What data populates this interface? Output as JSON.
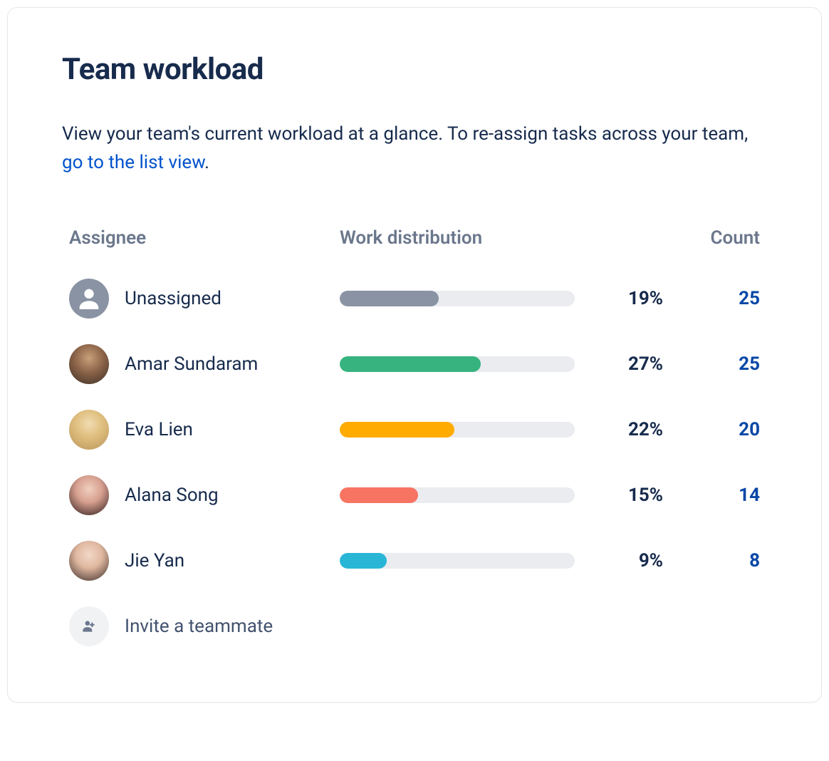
{
  "title": "Team workload",
  "description_prefix": "View your team's current workload at a glance. To re-assign tasks across your team, ",
  "description_link": "go to the list view",
  "description_suffix": ".",
  "columns": {
    "assignee": "Assignee",
    "distribution": "Work distribution",
    "count": "Count"
  },
  "rows": [
    {
      "name": "Unassigned",
      "percent": 19,
      "percent_label": "19%",
      "count": 25,
      "color": "#8993a4",
      "avatar": "unassigned"
    },
    {
      "name": "Amar Sundaram",
      "percent": 27,
      "percent_label": "27%",
      "count": 25,
      "color": "#36b37e",
      "avatar": "photo-1"
    },
    {
      "name": "Eva Lien",
      "percent": 22,
      "percent_label": "22%",
      "count": 20,
      "color": "#ffab00",
      "avatar": "photo-2"
    },
    {
      "name": "Alana Song",
      "percent": 15,
      "percent_label": "15%",
      "count": 14,
      "color": "#f87462",
      "avatar": "photo-3"
    },
    {
      "name": "Jie Yan",
      "percent": 9,
      "percent_label": "9%",
      "count": 8,
      "color": "#29b6d6",
      "avatar": "photo-4"
    }
  ],
  "invite_label": "Invite a teammate",
  "chart_data": {
    "type": "bar",
    "title": "Team workload",
    "xlabel": "Work distribution",
    "ylabel": "Assignee",
    "categories": [
      "Unassigned",
      "Amar Sundaram",
      "Eva Lien",
      "Alana Song",
      "Jie Yan"
    ],
    "series": [
      {
        "name": "Percent",
        "values": [
          19,
          27,
          22,
          15,
          9
        ]
      },
      {
        "name": "Count",
        "values": [
          25,
          25,
          20,
          14,
          8
        ]
      }
    ],
    "colors": [
      "#8993a4",
      "#36b37e",
      "#ffab00",
      "#f87462",
      "#29b6d6"
    ],
    "xlim": [
      0,
      100
    ]
  }
}
